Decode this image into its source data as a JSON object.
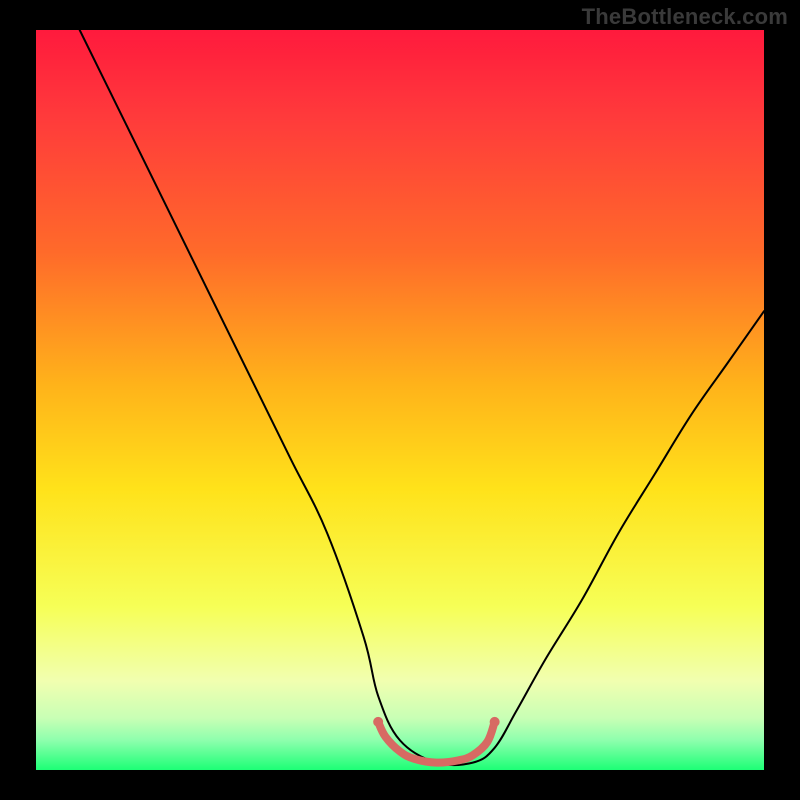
{
  "watermark": "TheBottleneck.com",
  "chart_data": {
    "type": "line",
    "title": "",
    "xlabel": "",
    "ylabel": "",
    "xlim": [
      0,
      100
    ],
    "ylim": [
      0,
      100
    ],
    "gradient_stops": [
      {
        "offset": 0,
        "color": "#ff1a3d"
      },
      {
        "offset": 12,
        "color": "#ff3b3b"
      },
      {
        "offset": 30,
        "color": "#ff6a2a"
      },
      {
        "offset": 48,
        "color": "#ffb31a"
      },
      {
        "offset": 62,
        "color": "#ffe21a"
      },
      {
        "offset": 78,
        "color": "#f6ff57"
      },
      {
        "offset": 88,
        "color": "#f1ffb0"
      },
      {
        "offset": 93,
        "color": "#c8ffb5"
      },
      {
        "offset": 96,
        "color": "#8dffad"
      },
      {
        "offset": 100,
        "color": "#1dff76"
      }
    ],
    "series": [
      {
        "name": "bottleneck-curve",
        "color": "#000000",
        "stroke_width": 2,
        "x": [
          6,
          10,
          15,
          20,
          25,
          30,
          35,
          40,
          45,
          47,
          50,
          55,
          60,
          63,
          66,
          70,
          75,
          80,
          85,
          90,
          95,
          100
        ],
        "values": [
          100,
          92,
          82,
          72,
          62,
          52,
          42,
          32,
          18,
          10,
          4,
          1,
          1,
          3,
          8,
          15,
          23,
          32,
          40,
          48,
          55,
          62
        ]
      },
      {
        "name": "optimal-band",
        "color": "#d76a63",
        "stroke_width": 8,
        "x": [
          47,
          48,
          50,
          52,
          55,
          58,
          60,
          62,
          63
        ],
        "values": [
          6.5,
          4.5,
          2.5,
          1.5,
          1,
          1.3,
          2,
          3.8,
          6.5
        ]
      }
    ]
  }
}
